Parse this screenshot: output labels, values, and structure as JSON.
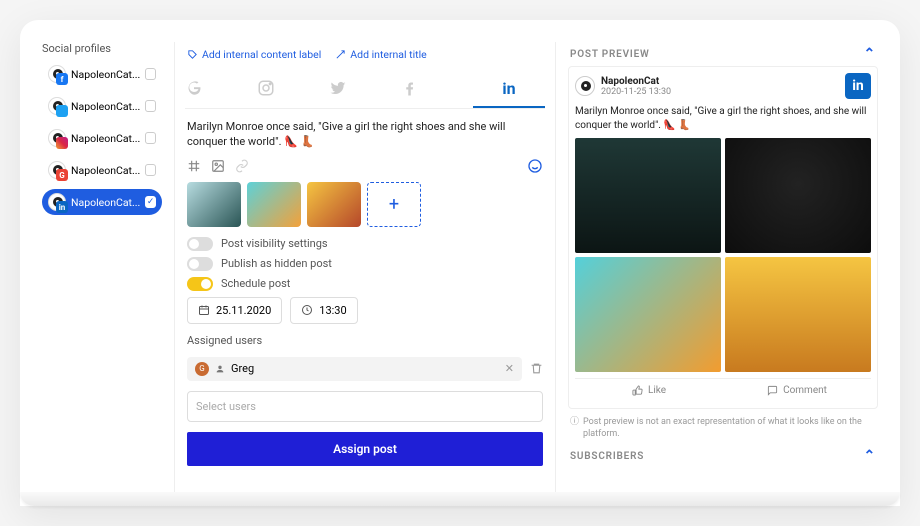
{
  "left": {
    "title": "Social profiles",
    "profiles": [
      {
        "name": "NapoleonCat...",
        "net": "fb"
      },
      {
        "name": "NapoleonCat...",
        "net": "tw"
      },
      {
        "name": "NapoleonCat...",
        "net": "ig"
      },
      {
        "name": "NapoleonCat...",
        "net": "gg"
      },
      {
        "name": "NapoleonCat...",
        "net": "li",
        "selected": true
      }
    ]
  },
  "mid": {
    "add_label": "Add internal content label",
    "add_title": "Add internal title",
    "post_text": "Marilyn Monroe once said, \"Give a girl the right shoes and she will conquer the world\". 👠 👢",
    "vis_label": "Post visibility settings",
    "hidden_label": "Publish as hidden post",
    "schedule_label": "Schedule post",
    "date": "25.11.2020",
    "time": "13:30",
    "assigned_title": "Assigned users",
    "user": "Greg",
    "select_placeholder": "Select users",
    "assign_btn": "Assign post"
  },
  "right": {
    "preview_title": "POST PREVIEW",
    "account": "NapoleonCat",
    "datetime": "2020-11-25 13:30",
    "post_text": "Marilyn Monroe once said, \"Give a girl the right shoes, and she will conquer the world\". 👠 👢",
    "like": "Like",
    "comment": "Comment",
    "disclaimer": "Post preview is not an exact representation of what it looks like on the platform.",
    "subscribers_title": "SUBSCRIBERS"
  }
}
